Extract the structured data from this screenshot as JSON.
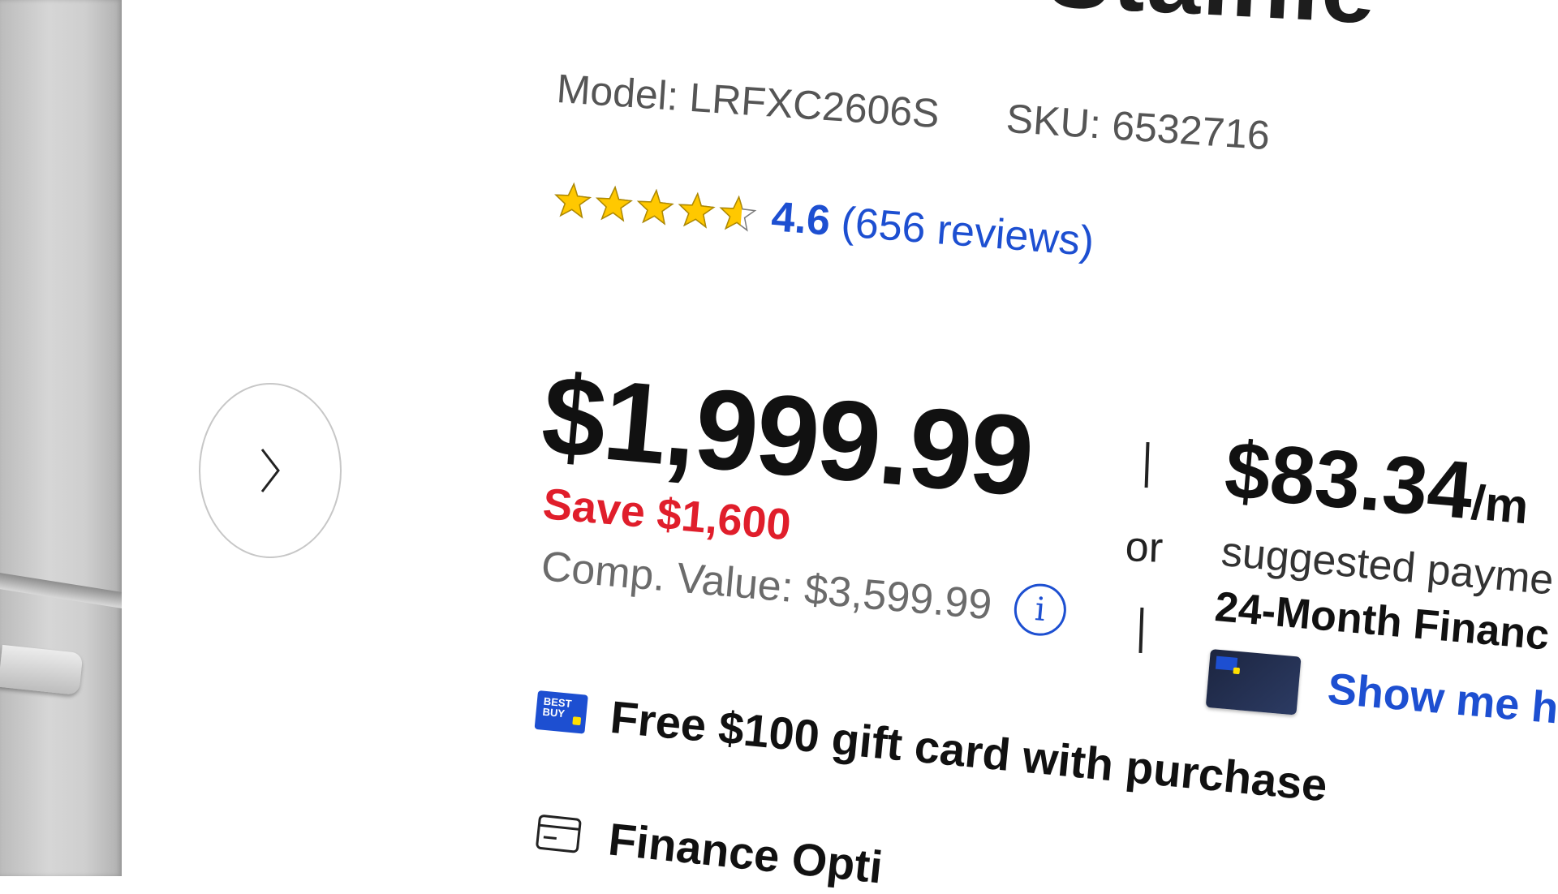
{
  "title_partial": "Stainle",
  "model": {
    "label": "Model:",
    "value": "LRFXC2606S"
  },
  "sku": {
    "label": "SKU:",
    "value": "6532716"
  },
  "rating": {
    "value": "4.6",
    "count_text": "(656 reviews)",
    "stars": 4.6
  },
  "price": {
    "current": "$1,999.99",
    "save_text": "Save $1,600",
    "comp_label": "Comp. Value:",
    "comp_value": "$3,599.99"
  },
  "divider_text": "or",
  "financing": {
    "monthly_amount": "$83.34",
    "monthly_suffix": "/m",
    "suggested_text": "suggested payme",
    "term_text": "24-Month Financ",
    "link_text": "Show me h"
  },
  "offers": {
    "gift_card_text": "Free $100 gift card with purchase",
    "finance_options_text": "Finance Opti"
  },
  "brand_logo_text": "BEST BUY",
  "colors": {
    "link": "#1d4fd1",
    "save": "#e01e2b",
    "star": "#ffc800"
  },
  "icons": [
    "chevron-right-icon",
    "star-icon",
    "info-icon",
    "best-buy-logo",
    "credit-card-icon",
    "card-image"
  ]
}
